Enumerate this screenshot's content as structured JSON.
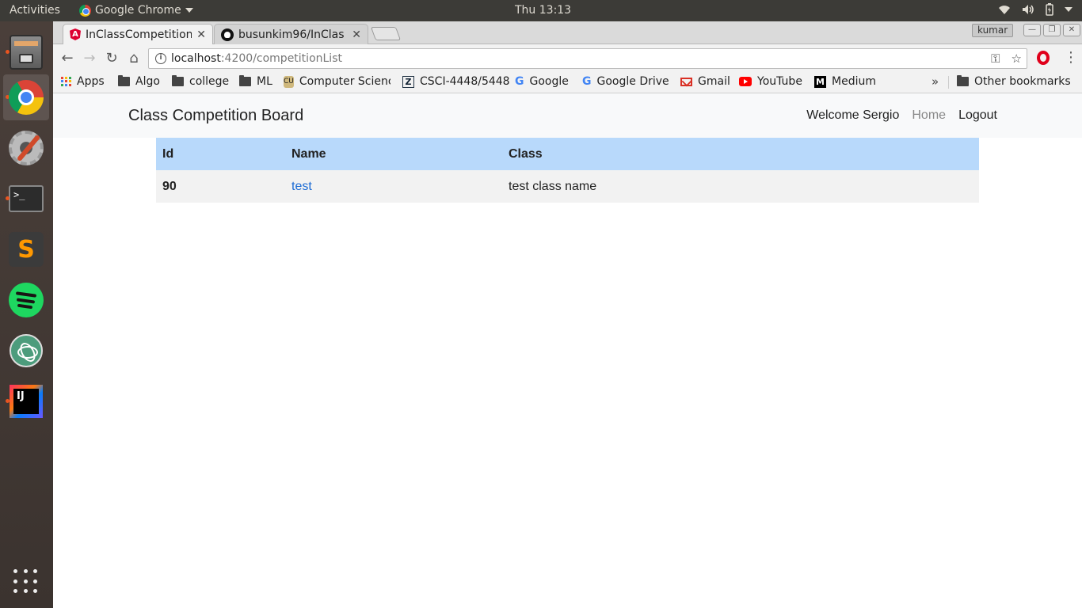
{
  "system_panel": {
    "activities": "Activities",
    "app_name": "Google Chrome",
    "clock": "Thu 13:13"
  },
  "launcher": {
    "items": [
      {
        "name": "Files"
      },
      {
        "name": "Google Chrome"
      },
      {
        "name": "System Settings"
      },
      {
        "name": "Terminal",
        "glyph": ">_"
      },
      {
        "name": "Sublime Text",
        "glyph": "S"
      },
      {
        "name": "Spotify"
      },
      {
        "name": "Atom"
      },
      {
        "name": "IntelliJ IDEA",
        "glyph": "IJ"
      },
      {
        "name": "Show Applications"
      }
    ]
  },
  "browser": {
    "tabs": [
      {
        "title": "InClassCompetition",
        "active": true,
        "icon": "angular-icon"
      },
      {
        "title": "busunkim96/InClas",
        "active": false,
        "icon": "github-icon"
      }
    ],
    "profile_name": "kumar",
    "address": {
      "host": "localhost",
      "path": ":4200/competitionList"
    },
    "bookmarks": [
      {
        "label": "Apps",
        "icon": "apps-icon"
      },
      {
        "label": "Algo",
        "icon": "folder-icon"
      },
      {
        "label": "college",
        "icon": "folder-icon"
      },
      {
        "label": "ML",
        "icon": "folder-icon"
      },
      {
        "label": "Computer Scienc",
        "icon": "cu-icon"
      },
      {
        "label": "CSCI-4448/5448",
        "icon": "z-icon"
      },
      {
        "label": "Google",
        "icon": "google-icon"
      },
      {
        "label": "Google Drive",
        "icon": "google-icon"
      },
      {
        "label": "Gmail",
        "icon": "gmail-icon"
      },
      {
        "label": "YouTube",
        "icon": "youtube-icon"
      },
      {
        "label": "Medium",
        "icon": "medium-icon"
      }
    ],
    "bookmarks_overflow": "»",
    "other_bookmarks": "Other bookmarks"
  },
  "app": {
    "brand": "Class Competition Board",
    "nav": {
      "welcome": "Welcome Sergio",
      "home": "Home",
      "logout": "Logout"
    },
    "table": {
      "headers": [
        "Id",
        "Name",
        "Class"
      ],
      "rows": [
        {
          "id": "90",
          "name": "test",
          "class": "test class name"
        }
      ]
    }
  },
  "colors": {
    "table_header": "#b8d9fb",
    "link": "#1a6ad4",
    "ubuntu_accent": "#e95420"
  }
}
